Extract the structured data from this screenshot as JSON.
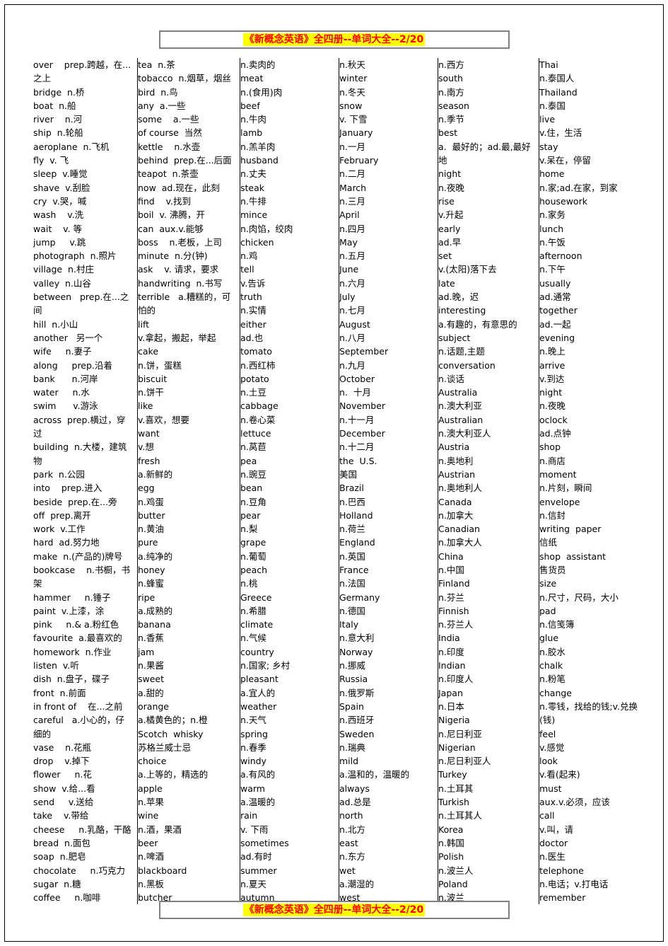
{
  "banner": {
    "title": "《新概念英语》全四册--单词大全--2/20"
  },
  "columns": [
    {
      "name": "column-1",
      "entries": [
        "over    prep.跨越，在...之上",
        "bridge  n.桥",
        "boat  n.船",
        "river    n.河",
        "ship  n.轮船",
        "aeroplane  n.飞机",
        "fly  v. 飞",
        "sleep  v.睡觉",
        "shave  v.刮脸",
        "cry  v.哭，喊",
        "wash    v.洗",
        "wait    v. 等",
        "jump     v.跳",
        "photograph  n.照片",
        "village  n.村庄",
        "valley  n.山谷",
        "between   prep.在...之间",
        "hill  n.小山",
        "another   另一个",
        "wife     n.妻子",
        "along     prep.沿着",
        "bank      n.河岸",
        "water     n.水",
        "swim      v.游泳",
        "across  prep.横过，穿过",
        "building  n.大楼，建筑物",
        "park  n.公园",
        "into    prep.进入",
        "beside  prep.在...旁",
        "off  prep.离开",
        "work  v.工作",
        "hard  ad.努力地",
        "make  n.(产品的)牌号",
        "bookcase    n.书橱，书架",
        "hammer     n.锤子",
        "paint  v.上漆，涂",
        "pink     n.& a.粉红色",
        "favourite  a.最喜欢的",
        "homework  n.作业",
        "listen  v.听",
        "dish  n.盘子，碟子",
        "front  n.前面",
        "in front of    在...之前",
        "careful   a.小心的，仔细的",
        "vase    n.花瓶",
        "drop    v.掉下",
        "flower     n.花",
        "show  v.给...看",
        "send     v.送给",
        "take    v.带给",
        "cheese     n.乳酪，干酪",
        "bread  n.面包",
        "soap  n.肥皂",
        "chocolate     n.巧克力",
        "sugar  n.糖",
        "coffee     n.咖啡"
      ]
    },
    {
      "name": "column-2",
      "entries": [
        "tea  n.茶",
        "tobacco  n.烟草，烟丝",
        "bird  n.鸟",
        "any  a.一些",
        "some    a.一些",
        "of course  当然",
        "kettle    n.水壶",
        "behind  prep.在...后面",
        "teapot  n.茶壶",
        "now  ad.现在，此刻",
        "find    v.找到",
        "boil  v. 沸腾，开",
        "can  aux.v.能够",
        "boss    n.老板，上司",
        "minute  n.分(钟)",
        "ask    v. 请求，要求",
        "handwriting  n.书写",
        "terrible   a.糟糕的，可怕的",
        "lift",
        "v.拿起，搬起，举起",
        "cake",
        "n.饼，蛋糕",
        "biscuit",
        "n.饼干",
        "like",
        "v.喜欢，想要",
        "want",
        "v.想",
        "fresh",
        "a.新鲜的",
        "egg",
        "n.鸡蛋",
        "butter",
        "n.黄油",
        "pure",
        "a.纯净的",
        "honey",
        "n.蜂蜜",
        "ripe",
        "a.成熟的",
        "banana",
        "n.香蕉",
        "jam",
        "n.果酱",
        "sweet",
        "a.甜的",
        "orange",
        "a.橘黄色的；n.橙",
        "Scotch  whisky",
        "苏格兰威士忌",
        "choice",
        "a.上等的，精选的",
        "apple",
        "n.苹果",
        "wine",
        "n.酒，果酒",
        "beer",
        "n.啤酒",
        "blackboard",
        "n.黑板",
        "butcher"
      ]
    },
    {
      "name": "column-3",
      "entries": [
        "n.卖肉的",
        "meat",
        "n.(食用)肉",
        "beef",
        "n.牛肉",
        "lamb",
        "n.羔羊肉",
        "husband",
        "n.丈夫",
        "steak",
        "n.牛排",
        "mince",
        "n.肉馅，绞肉",
        "chicken",
        "n.鸡",
        "tell",
        "v.告诉",
        "truth",
        "n.实情",
        "either",
        "ad.也",
        "tomato",
        "n.西红柿",
        "potato",
        "n.土豆",
        "cabbage",
        "n.卷心菜",
        "lettuce",
        "n.莴苣",
        "pea",
        "n.豌豆",
        "bean",
        "n.豆角",
        "pear",
        "n.梨",
        "grape",
        "n.葡萄",
        "peach",
        "n.桃",
        "Greece",
        "n.希腊",
        "climate",
        "n.气候",
        "country",
        "n.国家; 乡村",
        "pleasant",
        "a.宜人的",
        "weather",
        "n.天气",
        "spring",
        "n.春季",
        "windy",
        "a.有风的",
        "warm",
        "a.温暖的",
        "rain",
        "v. 下雨",
        "sometimes",
        "ad.有时",
        "summer",
        "n.夏天",
        "autumn"
      ]
    },
    {
      "name": "column-4",
      "entries": [
        "n.秋天",
        "winter",
        "n.冬天",
        "snow",
        "v. 下雪",
        "January",
        "n.一月",
        "February",
        "n.二月",
        "March",
        "n.三月",
        "April",
        "n.四月",
        "May",
        "n.五月",
        "June",
        "n.六月",
        "July",
        "n.七月",
        "August",
        "n.八月",
        "September",
        "n.九月",
        "October",
        "n.  十月",
        "November",
        "n.十一月",
        "December",
        "n.十二月",
        "the  U.S.",
        "美国",
        "Brazil",
        "n.巴西",
        "Holland",
        "n.荷兰",
        "England",
        "n.英国",
        "France",
        "n.法国",
        "Germany",
        "n.德国",
        "Italy",
        "n.意大利",
        "Norway",
        "n.挪威",
        "Russia",
        "n.俄罗斯",
        "Spain",
        "n.西班牙",
        "Sweden",
        "n.瑞典",
        "mild",
        "a.温和的，温暖的",
        "always",
        "ad.总是",
        "north",
        "n.北方",
        "east",
        "n.东方",
        "wet",
        "a.潮湿的",
        "west"
      ]
    },
    {
      "name": "column-5",
      "entries": [
        "n.西方",
        "south",
        "n.南方",
        "season",
        "n.季节",
        "best",
        "a.  最好的；ad.最,最好地",
        "night",
        "n.夜晚",
        "rise",
        "v.升起",
        "early",
        "ad.早",
        "set",
        "v.(太阳)落下去",
        "late",
        "ad.晚，迟",
        "interesting",
        "a.有趣的，有意思的",
        "subject",
        "n.话题,主题",
        "conversation",
        "n.谈话",
        "Australia",
        "n.澳大利亚",
        "Australian",
        "n.澳大利亚人",
        "Austria",
        "n.奥地利",
        "Austrian",
        "n.奥地利人",
        "Canada",
        "n.加拿大",
        "Canadian",
        "n.加拿大人",
        "China",
        "n.中国",
        "Finland",
        "n.芬兰",
        "Finnish",
        "n.芬兰人",
        "India",
        "n.印度",
        "Indian",
        "n.印度人",
        "Japan",
        "n.日本",
        "Nigeria",
        "n.尼日利亚",
        "Nigerian",
        "n.尼日利亚人",
        "Turkey",
        "n.土耳其",
        "Turkish",
        "n.土耳其人",
        "Korea",
        "n.韩国",
        "Polish",
        "n.波兰人",
        "Poland",
        "n.波兰"
      ]
    },
    {
      "name": "column-6",
      "entries": [
        "Thai",
        "n.泰国人",
        "Thailand",
        "n.泰国",
        "live",
        "v.住，生活",
        "stay",
        "v.呆在，停留",
        "home",
        "n.家;ad.在家，到家",
        "housework",
        "n.家务",
        "lunch",
        "n.午饭",
        "afternoon",
        "n.下午",
        "usually",
        "ad.通常",
        "together",
        "ad.一起",
        "evening",
        "n.晚上",
        "arrive",
        "v.到达",
        "night",
        "n.夜晚",
        "oclock",
        "ad.点钟",
        "shop",
        "n.商店",
        "moment",
        "n.片刻，瞬间",
        "envelope",
        "n.信封",
        "writing  paper",
        "信纸",
        "shop  assistant",
        "售货员",
        "size",
        "n.尺寸，尺码，大小",
        "pad",
        "n.信笺簿",
        "glue",
        "n.胶水",
        "chalk",
        "n.粉笔",
        "change",
        "n.零钱，找给的钱;v.兑换(钱)",
        "feel",
        "v.感觉",
        "look",
        "v.看(起来)",
        "must",
        "aux.v.必须，应该",
        "call",
        "v.叫，请",
        "doctor",
        "n.医生",
        "telephone",
        "n.电话；v.打电话",
        "remember"
      ]
    }
  ]
}
